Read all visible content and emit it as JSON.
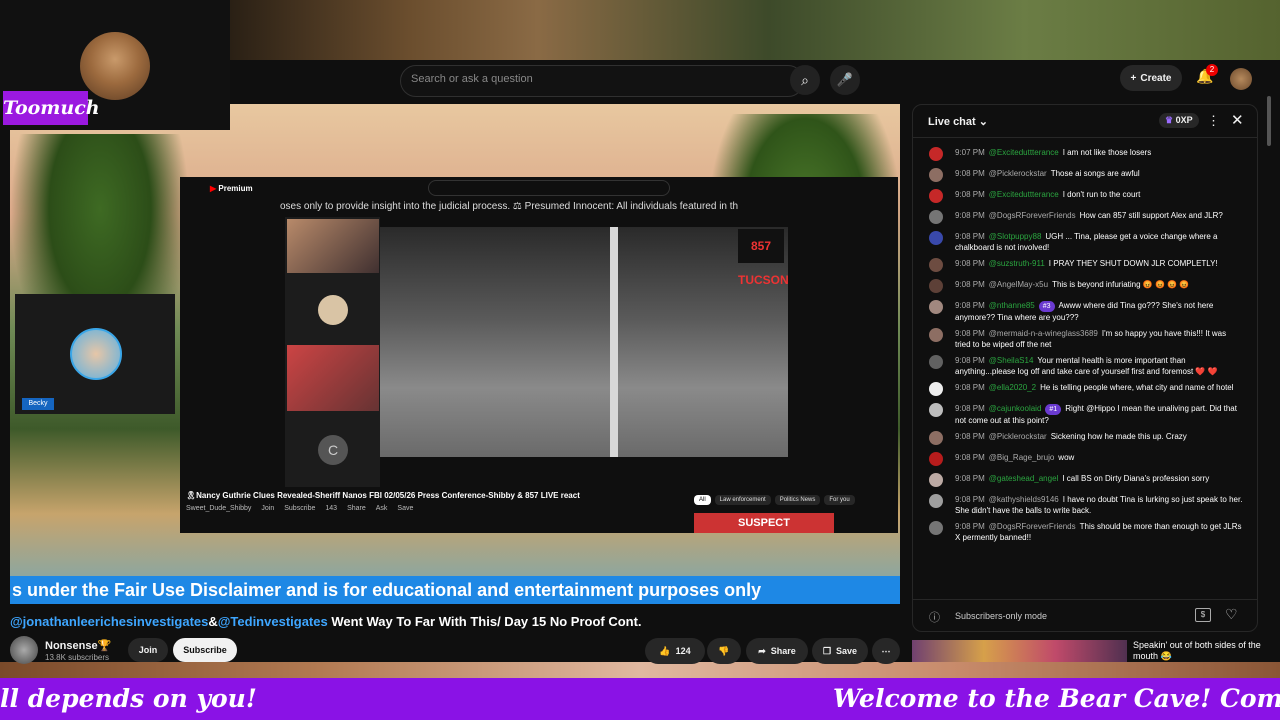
{
  "overlay": {
    "streamer_name": "Toomuch",
    "marquee_left": "ll depends on you!",
    "marquee_right": "Welcome to the Bear Cave! Come on in, wi"
  },
  "topbar": {
    "search_placeholder": "Search or ask a question",
    "create_label": "Create",
    "notification_count": "2"
  },
  "video": {
    "cam_tag": "Becky",
    "ticker": "s under the Fair Use Disclaimer and is for educational and entertainment purposes only",
    "inner": {
      "logo": "Premium",
      "crawl": "oses only to provide insight into the judicial process. ⚖ Presumed Innocent: All individuals featured in th",
      "badge": "857 TUCSON",
      "side_letter": "C",
      "title": "🎗Nancy Guthrie Clues Revealed-Sheriff Nanos FBI 02/05/26 Press Conference-Shibby & 857 LIVE react",
      "channel": "Sweet_Dude_Shibby",
      "join": "Join",
      "subscribe": "Subscribe",
      "likes": "143",
      "share": "Share",
      "ask": "Ask",
      "save": "Save",
      "chips": [
        "All",
        "Law enforcement",
        "Politics News",
        "For you"
      ],
      "suspect": "SUSPECT"
    }
  },
  "video_info": {
    "mention1": "@jonathanleerichesinvestigates",
    "amp": "&",
    "mention2": "@Tedinvestigates",
    "title_rest": " Went Way To Far With This/ Day 15 No Proof Cont.",
    "channel_name": "Nonsense🏆",
    "subscribers": "13.8K subscribers",
    "join_label": "Join",
    "subscribe_label": "Subscribe",
    "likes": "124",
    "share_label": "Share",
    "save_label": "Save"
  },
  "recommendation": {
    "title": "Speakin' out of both sides of the mouth 😂"
  },
  "chat": {
    "title": "Live chat",
    "xp": "0XP",
    "footer_label": "Subscribers-only mode",
    "messages": [
      {
        "time": "9:07 PM",
        "author": "@Exciteduttterance",
        "tag": "",
        "text": "I am not like those losers"
      },
      {
        "time": "9:08 PM",
        "author": "@Picklerockstar",
        "tag": "",
        "text": "Those ai songs are awful"
      },
      {
        "time": "9:08 PM",
        "author": "@Exciteduttterance",
        "tag": "",
        "text": "I don't run to the court"
      },
      {
        "time": "9:08 PM",
        "author": "@DogsRForeverFriends",
        "tag": "",
        "text": "How can 857 still support Alex and JLR?"
      },
      {
        "time": "9:08 PM",
        "author": "@Slotpuppy88",
        "tag": "",
        "text": "UGH ... Tina, please get a voice change where a chalkboard is not involved!"
      },
      {
        "time": "9:08 PM",
        "author": "@suzstruth-911",
        "tag": "",
        "text": "I PRAY THEY SHUT DOWN JLR COMPLETLY!"
      },
      {
        "time": "9:08 PM",
        "author": "@AngelMay-x5u",
        "tag": "",
        "text": "This is beyond infuriating 😡 😡 😡 😡"
      },
      {
        "time": "9:08 PM",
        "author": "@nthanne85",
        "tag": "#3",
        "text": "Awww where did Tina go??? She's not here anymore?? Tina where are you???"
      },
      {
        "time": "9:08 PM",
        "author": "@mermaid-n-a-wineglass3689",
        "tag": "",
        "text": "I'm so happy you have this!!! It was tried to be wiped off the net"
      },
      {
        "time": "9:08 PM",
        "author": "@SheilaS14",
        "tag": "",
        "text": "Your mental health is more important than anything...please log off and take care of yourself first and foremost ❤️ ❤️"
      },
      {
        "time": "9:08 PM",
        "author": "@ella2020_2",
        "tag": "",
        "text": "He is telling people where, what city and name of hotel"
      },
      {
        "time": "9:08 PM",
        "author": "@cajunkoolaid",
        "tag": "#1",
        "text": "Right @Hippo I mean the unaliving part. Did that not come out at this point?"
      },
      {
        "time": "9:08 PM",
        "author": "@Picklerockstar",
        "tag": "",
        "text": "Sickening how he made this up. Crazy"
      },
      {
        "time": "9:08 PM",
        "author": "@Big_Rage_brujo",
        "tag": "",
        "text": "wow"
      },
      {
        "time": "9:08 PM",
        "author": "@gateshead_angel",
        "tag": "",
        "text": "I call BS on Dirty Diana's profession sorry"
      },
      {
        "time": "9:08 PM",
        "author": "@kathyshields9146",
        "tag": "",
        "text": "I have no doubt Tina is lurking so just speak to her. She didn't have the balls to write back."
      },
      {
        "time": "9:08 PM",
        "author": "@DogsRForeverFriends",
        "tag": "",
        "text": "This should be more than enough to get JLRs X permently banned!!"
      }
    ]
  },
  "colors": {
    "accent_purple": "#8a12e6",
    "ticker_blue": "#1e88e5",
    "member_green": "#2ba640"
  }
}
